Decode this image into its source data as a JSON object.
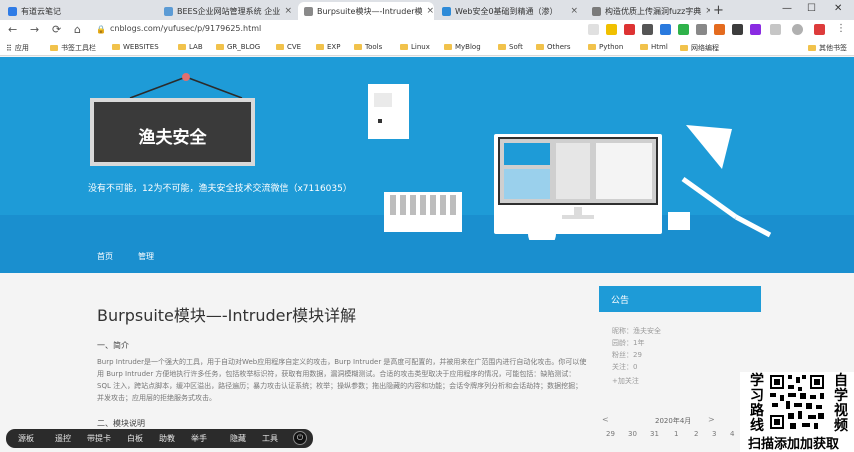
{
  "browser": {
    "tabs": [
      {
        "label": "有道云笔记",
        "color": "#2f7ce6"
      },
      {
        "label": "BEES企业网站管理系统 企业",
        "color": "#5b9bd5"
      },
      {
        "label": "Burpsuite模块—-Intruder模",
        "color": "#8a8a8a"
      },
      {
        "label": "Web安全0基础到精通（渗）",
        "color": "#2e8bd8"
      },
      {
        "label": "构造优质上传漏洞fuzz字典",
        "color": "#7a7a7a"
      }
    ],
    "tab_close": "×",
    "new_tab": "+",
    "window_controls": [
      "—",
      "☐",
      "✕"
    ],
    "url": "cnblogs.com/yufusec/p/9179625.html",
    "bookmarks": [
      "应用",
      "书签工具栏",
      "WEBSITES",
      "LAB",
      "GR_BLOG",
      "CVE",
      "EXP",
      "Tools",
      "Linux",
      "MyBlog",
      "Soft",
      "Others",
      "Python",
      "Html",
      "网络编程",
      "其他书签"
    ],
    "nav_icons": [
      "←",
      "→",
      "⟳",
      "⌂"
    ]
  },
  "banner": {
    "sign": "渔夫安全",
    "slogan": "没有不可能，12为不可能，渔夫安全技术交流微信（x7116035）"
  },
  "nav": {
    "items": [
      "首页",
      "管理"
    ]
  },
  "post": {
    "title": "Burpsuite模块—-Intruder模块详解",
    "section1": "一、简介",
    "para1": "Burp Intruder是一个强大的工具，用于自动对Web应用程序自定义的攻击，Burp Intruder 是高度可配置的，并被用来在广范围内进行自动化攻击。你可以使用 Burp Intruder 方便地执行许多任务，包括枚举标识符，获取有用数据，漏洞模糊测试。合适的攻击类型取决于应用程序的情况，可能包括：缺陷测试：SQL 注入，跨站点脚本，缓冲区溢出，路径遍历；暴力攻击认证系统；枚举；操纵参数；拖出隐藏的内容和功能；会话令牌序列分析和会话劫持；数据挖掘；并发攻击；应用层的拒绝服务式攻击。",
    "section2": "二、模块说明"
  },
  "sidebar": {
    "title": "公告",
    "lines": [
      "昵称：渔夫安全",
      "园龄：1年",
      "粉丝：29",
      "关注：0",
      "+加关注"
    ],
    "calendar_title": "2020年4月",
    "cal_prev": "<",
    "cal_next": ">",
    "cal_days": [
      "29",
      "30",
      "31",
      "1",
      "2",
      "3",
      "4"
    ]
  },
  "promo": {
    "left": "学习路线",
    "right": "自学视频",
    "bottom": "扫描添加加获取"
  },
  "floating_toolbar": {
    "items": [
      "源板",
      "遥控",
      "带提卡",
      "白板",
      "助教",
      "举手",
      "隐藏",
      "工具"
    ],
    "power": "⏻"
  }
}
